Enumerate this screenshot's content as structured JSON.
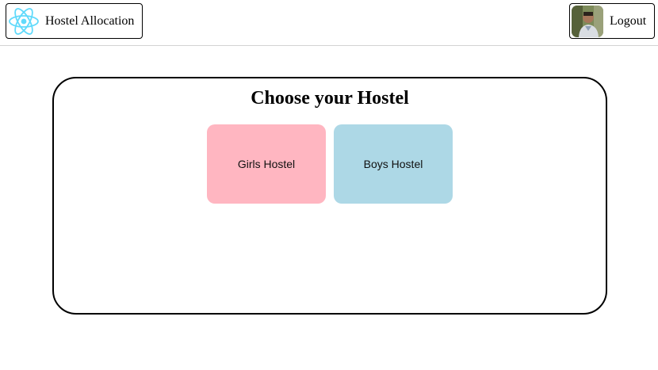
{
  "header": {
    "brand": {
      "title": "Hostel Allocation",
      "icon": "react-atom-icon"
    },
    "logout": {
      "label": "Logout",
      "avatar": "user-avatar"
    }
  },
  "main": {
    "title": "Choose your Hostel",
    "options": [
      {
        "label": "Girls Hostel",
        "color": "#ffb6c1"
      },
      {
        "label": "Boys Hostel",
        "color": "#add8e6"
      }
    ]
  },
  "colors": {
    "react_blue": "#61dafb",
    "border": "#000000",
    "divider": "#d3d3d3"
  }
}
